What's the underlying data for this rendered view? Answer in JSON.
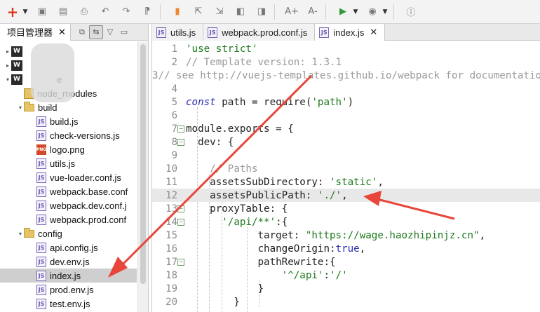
{
  "toolbar": {
    "icons": [
      "new-icon",
      "save-icon",
      "save-all-icon",
      "print-icon",
      "undo-icon",
      "redo-icon",
      "format-icon",
      "bookmark-icon",
      "import-icon",
      "export-icon",
      "find-prev-icon",
      "find-next-icon",
      "font-increase-icon",
      "font-decrease-icon",
      "run-icon",
      "preview-icon",
      "info-icon"
    ],
    "labels": {
      "new": "+",
      "font_increase": "A+",
      "font_decrease": "A-"
    }
  },
  "left_panel": {
    "title": "项目管理器",
    "close": "✕",
    "tree": [
      {
        "label": "W",
        "type": "workspace",
        "indent": 0,
        "twisty": "▸"
      },
      {
        "label": "W",
        "type": "workspace",
        "indent": 0,
        "twisty": "▸"
      },
      {
        "label": "W",
        "type": "workspace",
        "indent": 0,
        "twisty": "▾",
        "suffix": "e"
      },
      {
        "label": "node_modules",
        "type": "modules",
        "indent": 1,
        "twisty": ""
      },
      {
        "label": "build",
        "type": "folder",
        "indent": 1,
        "twisty": "▾"
      },
      {
        "label": "build.js",
        "type": "js",
        "indent": 2,
        "twisty": ""
      },
      {
        "label": "check-versions.js",
        "type": "js",
        "indent": 2,
        "twisty": ""
      },
      {
        "label": "logo.png",
        "type": "png",
        "indent": 2,
        "twisty": ""
      },
      {
        "label": "utils.js",
        "type": "js",
        "indent": 2,
        "twisty": ""
      },
      {
        "label": "vue-loader.conf.js",
        "type": "js",
        "indent": 2,
        "twisty": ""
      },
      {
        "label": "webpack.base.conf",
        "type": "js",
        "indent": 2,
        "twisty": ""
      },
      {
        "label": "webpack.dev.conf.j",
        "type": "js",
        "indent": 2,
        "twisty": ""
      },
      {
        "label": "webpack.prod.conf",
        "type": "js",
        "indent": 2,
        "twisty": ""
      },
      {
        "label": "config",
        "type": "folder",
        "indent": 1,
        "twisty": "▾"
      },
      {
        "label": "api.config.js",
        "type": "js",
        "indent": 2,
        "twisty": ""
      },
      {
        "label": "dev.env.js",
        "type": "js",
        "indent": 2,
        "twisty": ""
      },
      {
        "label": "index.js",
        "type": "js",
        "indent": 2,
        "twisty": "",
        "selected": true
      },
      {
        "label": "prod.env.js",
        "type": "js",
        "indent": 2,
        "twisty": ""
      },
      {
        "label": "test.env.js",
        "type": "js",
        "indent": 2,
        "twisty": ""
      }
    ]
  },
  "editor": {
    "tabs": [
      {
        "label": "utils.js",
        "active": false
      },
      {
        "label": "webpack.prod.conf.js",
        "active": false
      },
      {
        "label": "index.js",
        "active": true,
        "close": "✕"
      }
    ],
    "current_line": 12,
    "lines": [
      {
        "n": "1",
        "fold": "",
        "tokens": [
          [
            "s",
            "'use strict'"
          ]
        ]
      },
      {
        "n": "2",
        "fold": "",
        "tokens": [
          [
            "c",
            "// Template version: 1.3.1"
          ]
        ]
      },
      {
        "n": "3",
        "fold": "",
        "tokens": [
          [
            "c",
            "// see http://vuejs-templates.github.io/webpack for documentation."
          ]
        ]
      },
      {
        "n": "4",
        "fold": "",
        "tokens": []
      },
      {
        "n": "5",
        "fold": "",
        "tokens": [
          [
            "k",
            "const"
          ],
          [
            "n",
            " path = require("
          ],
          [
            "s",
            "'path'"
          ],
          [
            "n",
            ")"
          ]
        ]
      },
      {
        "n": "6",
        "fold": "",
        "tokens": []
      },
      {
        "n": "7",
        "fold": "−",
        "tokens": [
          [
            "n",
            "module.exports = {"
          ]
        ]
      },
      {
        "n": "8",
        "fold": "−",
        "tokens": [
          [
            "n",
            "  dev: {"
          ]
        ]
      },
      {
        "n": "9",
        "fold": "",
        "tokens": []
      },
      {
        "n": "10",
        "fold": "",
        "tokens": [
          [
            "n",
            "    "
          ],
          [
            "c",
            "// Paths"
          ]
        ]
      },
      {
        "n": "11",
        "fold": "",
        "tokens": [
          [
            "n",
            "    assetsSubDirectory: "
          ],
          [
            "s",
            "'static'"
          ],
          [
            "n",
            ","
          ]
        ]
      },
      {
        "n": "12",
        "fold": "",
        "tokens": [
          [
            "n",
            "    assetsPublicPath: "
          ],
          [
            "s",
            "'./'"
          ],
          [
            "n",
            ","
          ]
        ]
      },
      {
        "n": "13",
        "fold": "−",
        "tokens": [
          [
            "n",
            "    proxyTable: {"
          ]
        ]
      },
      {
        "n": "14",
        "fold": "−",
        "tokens": [
          [
            "n",
            "      "
          ],
          [
            "s",
            "'/api/**'"
          ],
          [
            "n",
            ":{"
          ]
        ]
      },
      {
        "n": "15",
        "fold": "",
        "tokens": [
          [
            "n",
            "            target: "
          ],
          [
            "s",
            "\"https://wage.haozhipinjz.cn\""
          ],
          [
            "n",
            ","
          ]
        ]
      },
      {
        "n": "16",
        "fold": "",
        "tokens": [
          [
            "n",
            "            changeOrigin:"
          ],
          [
            "kw",
            "true"
          ],
          [
            "n",
            ","
          ]
        ]
      },
      {
        "n": "17",
        "fold": "−",
        "tokens": [
          [
            "n",
            "            pathRewrite:{"
          ]
        ]
      },
      {
        "n": "18",
        "fold": "",
        "tokens": [
          [
            "n",
            "                "
          ],
          [
            "s",
            "'^/api'"
          ],
          [
            "n",
            ":"
          ],
          [
            "s",
            "'/'"
          ]
        ]
      },
      {
        "n": "19",
        "fold": "",
        "tokens": [
          [
            "n",
            "            }"
          ]
        ]
      },
      {
        "n": "20",
        "fold": "",
        "tokens": [
          [
            "n",
            "        }"
          ]
        ]
      }
    ]
  },
  "colors": {
    "annotation_arrow": "#e8463a",
    "string": "#1d7a1d",
    "comment": "#9a9a9a",
    "keyword": "#2b2bb3"
  }
}
